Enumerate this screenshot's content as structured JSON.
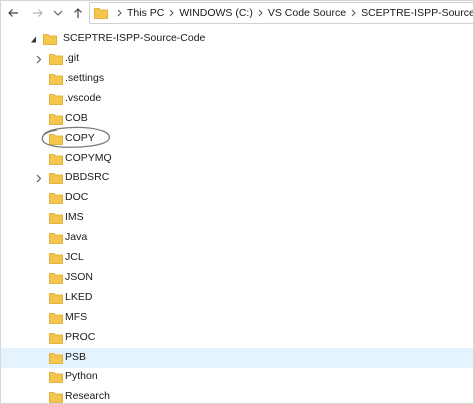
{
  "nav": {
    "back_icon": "arrow-left-icon",
    "forward_icon": "arrow-right-icon",
    "recent_icon": "chevron-down-icon",
    "up_icon": "arrow-up-icon",
    "breadcrumb": [
      "This PC",
      "WINDOWS (C:)",
      "VS Code Source",
      "SCEPTRE-ISPP-Source-Code"
    ]
  },
  "tree": {
    "root": {
      "label": "SCEPTRE-ISPP-Source-Code",
      "expanded": true
    },
    "items": [
      {
        "label": ".git",
        "expandable": true
      },
      {
        "label": ".settings",
        "expandable": false
      },
      {
        "label": ".vscode",
        "expandable": false
      },
      {
        "label": "COB",
        "expandable": false
      },
      {
        "label": "COPY",
        "expandable": false,
        "annotated": true
      },
      {
        "label": "COPYMQ",
        "expandable": false
      },
      {
        "label": "DBDSRC",
        "expandable": true
      },
      {
        "label": "DOC",
        "expandable": false
      },
      {
        "label": "IMS",
        "expandable": false
      },
      {
        "label": "Java",
        "expandable": false
      },
      {
        "label": "JCL",
        "expandable": false
      },
      {
        "label": "JSON",
        "expandable": false
      },
      {
        "label": "LKED",
        "expandable": false
      },
      {
        "label": "MFS",
        "expandable": false
      },
      {
        "label": "PROC",
        "expandable": false
      },
      {
        "label": "PSB",
        "expandable": false,
        "hovered": true
      },
      {
        "label": "Python",
        "expandable": false
      },
      {
        "label": "Research",
        "expandable": false
      }
    ]
  },
  "colors": {
    "folder_fill": "#f4c64d",
    "folder_dark": "#d9a520",
    "hover": "#e5f3ff",
    "annotation": "#7a7a7a"
  }
}
